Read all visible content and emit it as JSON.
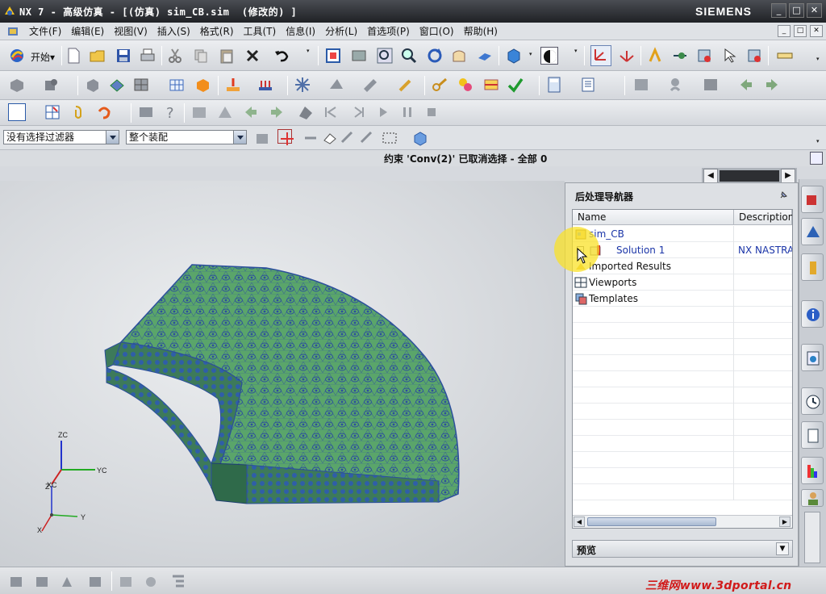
{
  "window": {
    "title": "NX 7 - 高级仿真 - [(仿真) sim_CB.sim  (修改的) ]",
    "brand": "SIEMENS",
    "controls": [
      "_",
      "□",
      "✕"
    ]
  },
  "menu": {
    "items": [
      "文件(F)",
      "编辑(E)",
      "视图(V)",
      "插入(S)",
      "格式(R)",
      "工具(T)",
      "信息(I)",
      "分析(L)",
      "首选项(P)",
      "窗口(O)",
      "帮助(H)"
    ],
    "mdi_controls": [
      "_",
      "□",
      "✕"
    ]
  },
  "toolbar": {
    "start_label": "开始▾"
  },
  "selection": {
    "filter_value": "没有选择过滤器",
    "scope_value": "整个装配"
  },
  "status": {
    "message": "约束 'Conv(2)' 已取消选择 - 全部 0"
  },
  "navigator": {
    "title": "后处理导航器",
    "columns": [
      "Name",
      "Description"
    ],
    "rows": [
      {
        "label": "sim_CB",
        "desc": "",
        "icon": "sim-folder-icon",
        "indent": 0
      },
      {
        "label": "Solution 1",
        "desc": "NX NASTRAN",
        "icon": "solution-icon",
        "indent": 2
      },
      {
        "label": "Imported Results",
        "desc": "",
        "icon": "imported-results-icon",
        "indent": 1
      },
      {
        "label": "Viewports",
        "desc": "",
        "icon": "viewports-icon",
        "indent": 0
      },
      {
        "label": "Templates",
        "desc": "",
        "icon": "templates-icon",
        "indent": 0
      }
    ],
    "preview_label": "预览"
  },
  "viewport": {
    "triad_labels": [
      "ZC",
      "YC",
      "XC",
      "Z",
      "Y",
      "X"
    ]
  },
  "watermark": "三维网www.3dportal.cn",
  "colors": {
    "mesh_fill": "#5aa56a",
    "mesh_edge": "#2c4f9c",
    "accent_blue": "#1b35a8",
    "watermark_red": "#d11a1a"
  }
}
